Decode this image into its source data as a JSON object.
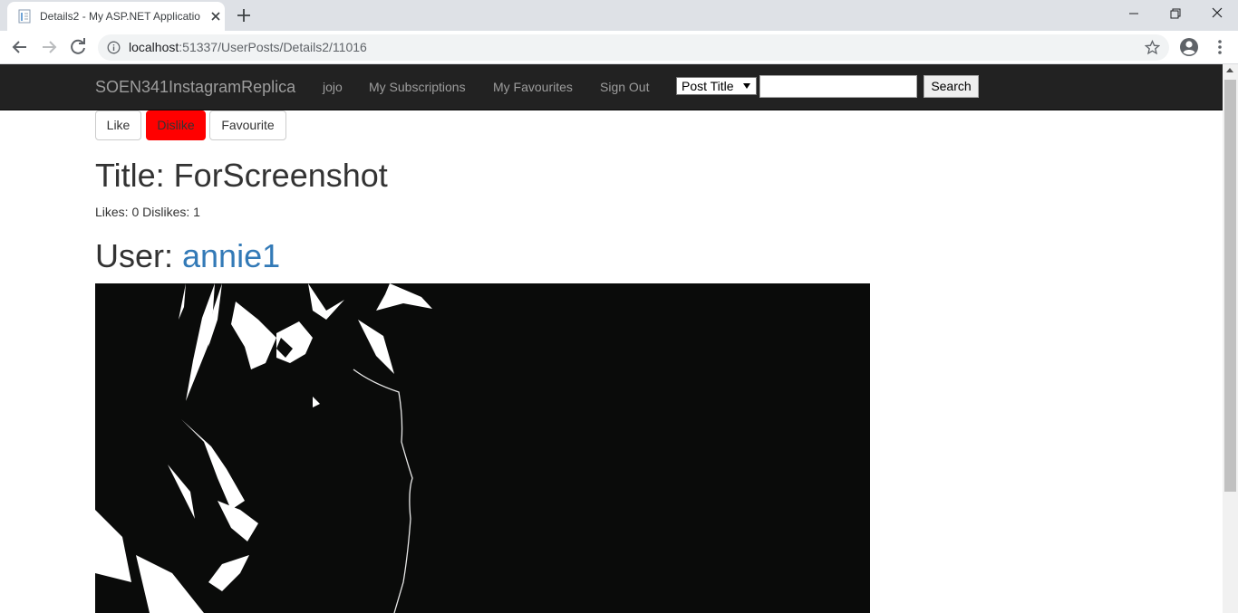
{
  "browser": {
    "tab_title": "Details2 - My ASP.NET Applicatio",
    "url_host": "localhost",
    "url_path": ":51337/UserPosts/Details2/11016"
  },
  "navbar": {
    "brand": "SOEN341InstagramReplica",
    "links": [
      "jojo",
      "My Subscriptions",
      "My Favourites",
      "Sign Out"
    ],
    "search_type_selected": "Post Title",
    "search_value": "",
    "search_button": "Search"
  },
  "actions": {
    "like": "Like",
    "dislike": "Dislike",
    "favourite": "Favourite"
  },
  "post": {
    "title": "Title: ForScreenshot",
    "counts": "Likes: 0 Dislikes: 1",
    "user_prefix": "User: ",
    "user_name": "annie1"
  },
  "colors": {
    "navbar_bg": "#222222",
    "dislike_active": "#ff0000",
    "link": "#337ab7"
  },
  "icons": [
    "page-favicon-icon",
    "close-icon",
    "plus-icon",
    "back-arrow-icon",
    "forward-arrow-icon",
    "reload-icon",
    "info-icon",
    "star-icon",
    "profile-icon",
    "menu-dots-icon"
  ]
}
